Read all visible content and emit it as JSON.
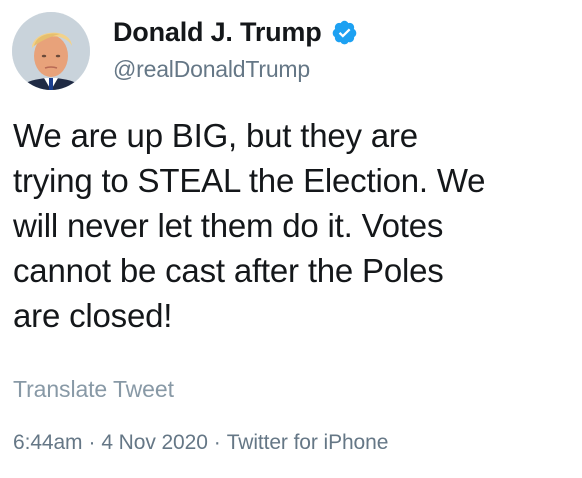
{
  "tweet": {
    "author": {
      "display_name": "Donald J. Trump",
      "handle": "@realDonaldTrump",
      "verified": true,
      "avatar_icon": "profile-photo",
      "verified_icon": "verified-badge-icon"
    },
    "text": "We are up BIG, but they are\ntrying to STEAL the Election. We\nwill never let them do it. Votes\ncannot be cast after the Poles\nare closed!",
    "translate_label": "Translate Tweet",
    "time": "6:44am",
    "date": "4 Nov 2020",
    "separator": "·",
    "source": "Twitter for iPhone"
  },
  "colors": {
    "text_primary": "#14171a",
    "text_secondary": "#657786",
    "translate_link": "#8899a6",
    "verified_blue": "#1da1f2",
    "background": "#ffffff"
  }
}
